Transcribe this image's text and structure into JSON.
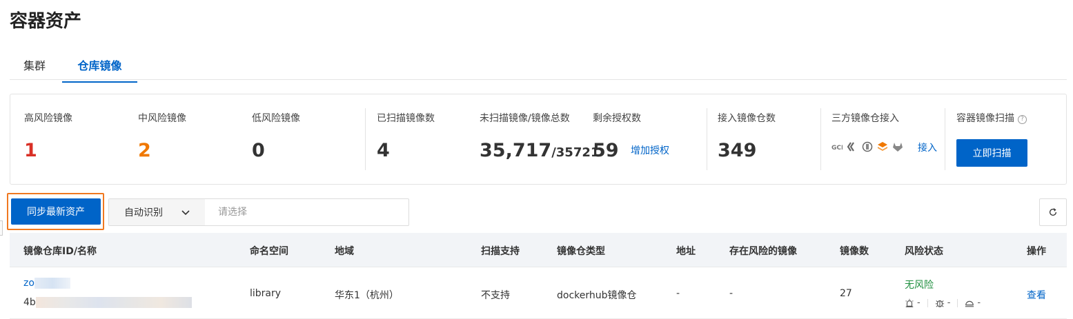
{
  "page": {
    "title": "容器资产"
  },
  "tabs": [
    {
      "label": "集群",
      "active": false
    },
    {
      "label": "仓库镜像",
      "active": true
    }
  ],
  "stats": {
    "high_risk": {
      "label": "高风险镜像",
      "value": "1"
    },
    "mid_risk": {
      "label": "中风险镜像",
      "value": "2"
    },
    "low_risk": {
      "label": "低风险镜像",
      "value": "0"
    },
    "scanned": {
      "label": "已扫描镜像数",
      "value": "4"
    },
    "unscanned": {
      "label": "未扫描镜像/镜像总数",
      "value": "35,717",
      "total": "/35721"
    },
    "license": {
      "label": "剩余授权数",
      "value": "59",
      "link": "增加授权"
    },
    "repos": {
      "label": "接入镜像仓数",
      "value": "349"
    },
    "third_party": {
      "label": "三方镜像仓接入",
      "link": "接入",
      "icons": [
        "gcr-icon",
        "quay-icon",
        "harbor-icon",
        "jfrog-icon",
        "gitlab-icon"
      ]
    },
    "scan": {
      "label": "容器镜像扫描",
      "button": "立即扫描"
    }
  },
  "colors": {
    "primary": "#0064c8",
    "high": "#d93026",
    "mid": "#f07800",
    "safe": "#1e8e3e",
    "highlight": "#f07820"
  },
  "toolbar": {
    "sync_label": "同步最新资产",
    "filter_select": "自动识别",
    "filter_placeholder": "请选择"
  },
  "table": {
    "headers": [
      "镜像仓库ID/名称",
      "命名空间",
      "地域",
      "扫描支持",
      "镜像仓类型",
      "地址",
      "存在风险的镜像",
      "镜像数",
      "风险状态",
      "操作"
    ],
    "rows": [
      {
        "id_prefix": "zo",
        "name_prefix": "4b",
        "namespace": "library",
        "region": "华东1（杭州）",
        "scan_support": "不支持",
        "repo_type": "dockerhub镜像仓",
        "address": "-",
        "risk_images": "-",
        "image_count": "27",
        "risk_status": "无风险",
        "risk_counts": {
          "alarm": "-",
          "bug": "-",
          "baseline": "-"
        },
        "action": "查看"
      }
    ]
  }
}
